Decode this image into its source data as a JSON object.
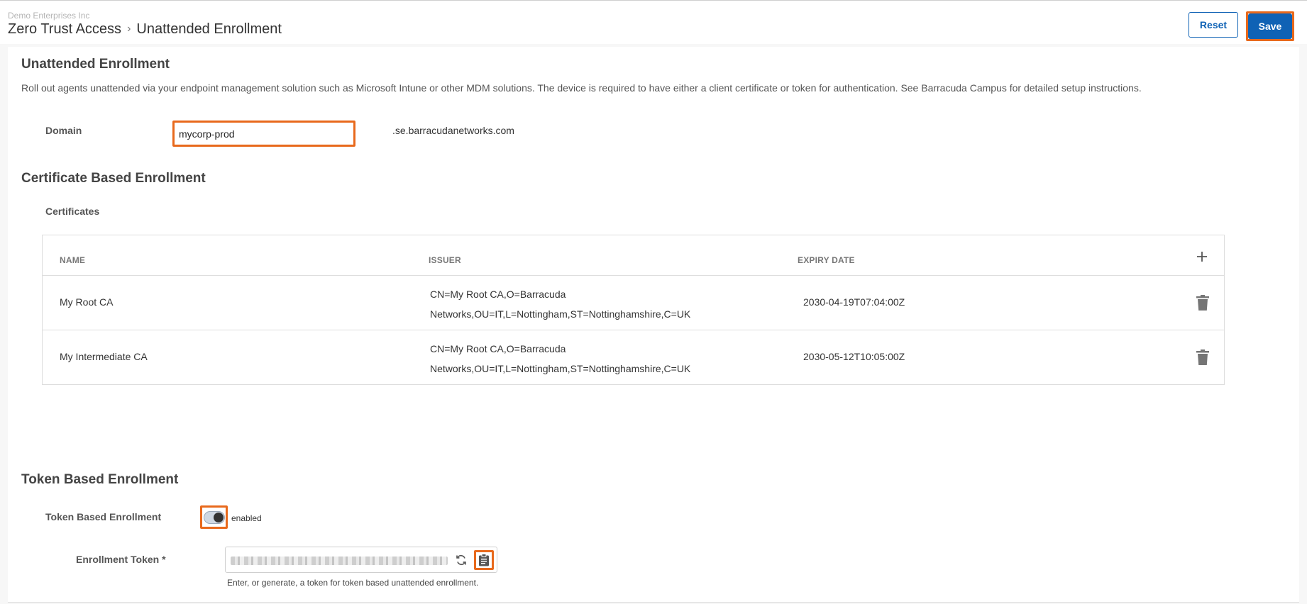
{
  "header": {
    "org": "Demo Enterprises Inc",
    "breadcrumb": [
      "Zero Trust Access",
      "Unattended Enrollment"
    ],
    "separator": "›",
    "reset_label": "Reset",
    "save_label": "Save"
  },
  "unattended": {
    "title": "Unattended Enrollment",
    "description": "Roll out agents unattended via your endpoint management solution such as Microsoft Intune or other MDM solutions. The device is required to have either a client certificate or token for authentication. See Barracuda Campus for detailed setup instructions.",
    "domain_label": "Domain",
    "domain_value": "mycorp-prod",
    "domain_suffix": ".se.barracudanetworks.com"
  },
  "certificates": {
    "title": "Certificate Based Enrollment",
    "subtitle": "Certificates",
    "columns": [
      "NAME",
      "ISSUER",
      "EXPIRY DATE"
    ],
    "rows": [
      {
        "name": "My Root CA",
        "issuer_line1": "CN=My Root CA,O=Barracuda",
        "issuer_line2": "Networks,OU=IT,L=Nottingham,ST=Nottinghamshire,C=UK",
        "expiry": "2030-04-19T07:04:00Z"
      },
      {
        "name": "My Intermediate CA",
        "issuer_line1": "CN=My Root CA,O=Barracuda",
        "issuer_line2": "Networks,OU=IT,L=Nottingham,ST=Nottinghamshire,C=UK",
        "expiry": "2030-05-12T10:05:00Z"
      }
    ],
    "add_icon": "plus-icon",
    "delete_icon": "trash-icon"
  },
  "token": {
    "title": "Token Based Enrollment",
    "toggle_label": "Token Based Enrollment",
    "toggle_state": "enabled",
    "enrollment_label": "Enrollment Token *",
    "helper": "Enter, or generate, a token for token based unattended enrollment.",
    "refresh_icon": "refresh-icon",
    "copy_icon": "clipboard-icon"
  },
  "colors": {
    "accent": "#0f62b5",
    "highlight": "#e8691c"
  }
}
